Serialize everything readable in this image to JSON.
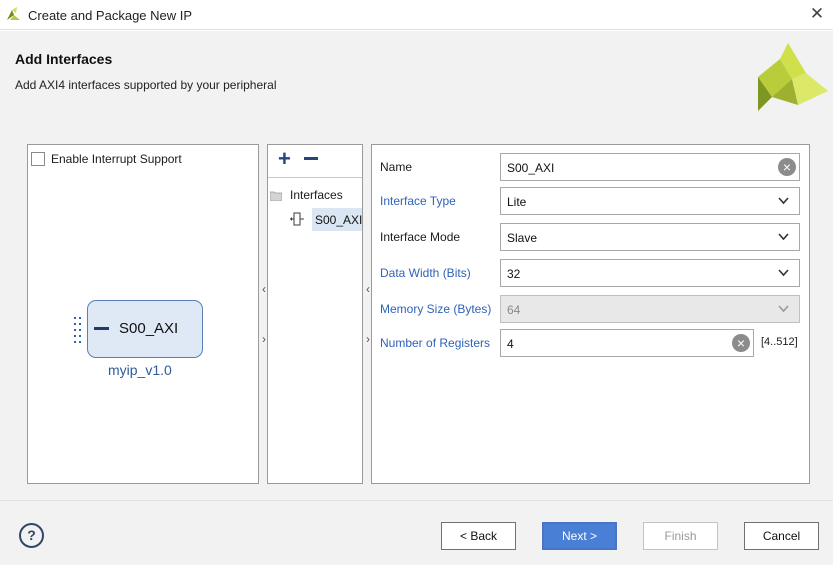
{
  "window": {
    "title": "Create and Package New IP",
    "close_glyph": "✕"
  },
  "header": {
    "title": "Add Interfaces",
    "subtitle": "Add AXI4 interfaces supported by your peripheral"
  },
  "left_panel": {
    "interrupt_label": "Enable Interrupt Support",
    "interrupt_checked": false,
    "ip_interface": "S00_AXI",
    "ip_name": "myip_v1.0"
  },
  "middle_panel": {
    "add_glyph": "+",
    "tree_root": "Interfaces",
    "tree_item": "S00_AXI"
  },
  "form": {
    "name": {
      "label": "Name",
      "value": "S00_AXI"
    },
    "interface_type": {
      "label": "Interface Type",
      "value": "Lite"
    },
    "interface_mode": {
      "label": "Interface Mode",
      "value": "Slave"
    },
    "data_width": {
      "label": "Data Width (Bits)",
      "value": "32"
    },
    "memory_size": {
      "label": "Memory Size (Bytes)",
      "value": "64"
    },
    "num_registers": {
      "label": "Number of Registers",
      "value": "4",
      "range": "[4..512]"
    }
  },
  "footer": {
    "help": "?",
    "back": "< Back",
    "next": "Next >",
    "finish": "Finish",
    "cancel": "Cancel"
  },
  "arrows": {
    "left": "‹",
    "right": "›"
  },
  "colors": {
    "accent": "#4a7fd6",
    "link_label": "#2f63b8",
    "ip_box": "#dfe8f5",
    "logo_green": "#8fa52a"
  }
}
